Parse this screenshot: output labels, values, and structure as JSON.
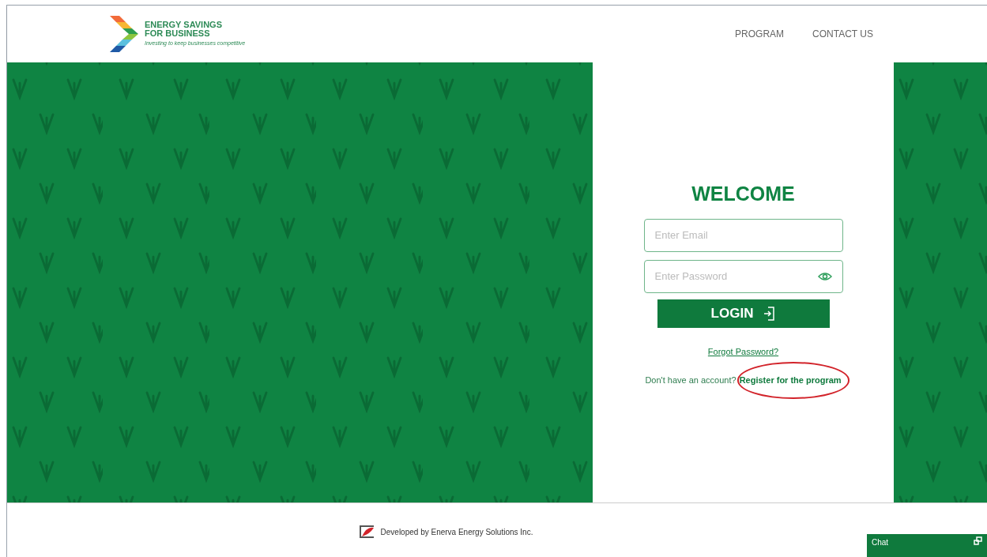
{
  "header": {
    "logo": {
      "title_line_1": "ENERGY SAVINGS",
      "title_line_2": "FOR BUSINESS",
      "tagline": "Investing to keep businesses competitive"
    },
    "nav": [
      {
        "label": "PROGRAM"
      },
      {
        "label": "CONTACT US"
      }
    ]
  },
  "login": {
    "title": "WELCOME",
    "email": {
      "placeholder": "Enter Email"
    },
    "password": {
      "placeholder": "Enter Password"
    },
    "button": "LOGIN",
    "forgot": "Forgot Password?",
    "register_prompt": "Don't have an account?",
    "register_link": "Register for the program",
    "register_highlighted": true
  },
  "footer": {
    "credit": "Developed by Enerva Energy Solutions Inc."
  },
  "chat": {
    "label": "Chat"
  }
}
